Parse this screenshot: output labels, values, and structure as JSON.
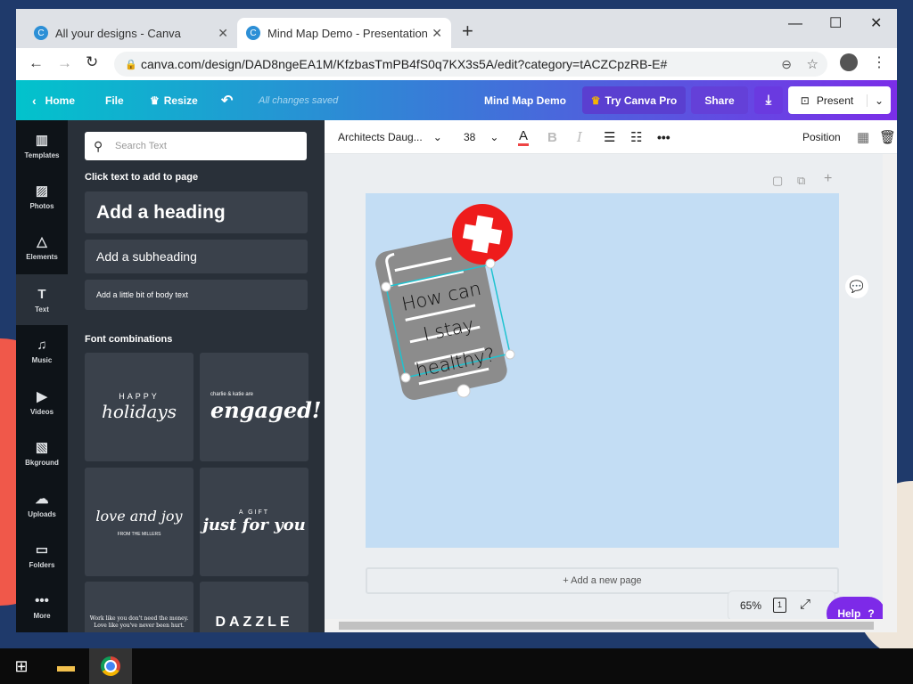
{
  "browser": {
    "tabs": [
      {
        "title": "All your designs - Canva",
        "favicon": "C"
      },
      {
        "title": "Mind Map Demo - Presentation",
        "favicon": "C"
      }
    ],
    "new_tab": "+",
    "url": "canva.com/design/DAD8ngeEA1M/KfzbasTmPB4fS0q7KX3s5A/edit?category=tACZCpzRB-E#"
  },
  "header": {
    "home": "Home",
    "file": "File",
    "resize": "Resize",
    "status": "All changes saved",
    "doc_title": "Mind Map Demo",
    "try_pro": "Try Canva Pro",
    "share": "Share",
    "present": "Present"
  },
  "rail": [
    {
      "label": "Templates",
      "icon": "▥"
    },
    {
      "label": "Photos",
      "icon": "▨"
    },
    {
      "label": "Elements",
      "icon": "△"
    },
    {
      "label": "Text",
      "icon": "T"
    },
    {
      "label": "Music",
      "icon": "♫"
    },
    {
      "label": "Videos",
      "icon": "▶"
    },
    {
      "label": "Bkground",
      "icon": "▧"
    },
    {
      "label": "Uploads",
      "icon": "☁"
    },
    {
      "label": "Folders",
      "icon": "▭"
    },
    {
      "label": "More",
      "icon": "•••"
    }
  ],
  "panel": {
    "search_placeholder": "Search Text",
    "click_to_add": "Click text to add to page",
    "heading": "Add a heading",
    "subheading": "Add a subheading",
    "body": "Add a little bit of body text",
    "font_combos_title": "Font combinations",
    "combos": [
      {
        "small": "HAPPY",
        "big": "holidays",
        "sub": ""
      },
      {
        "small": "charlie & katie are",
        "big": "engaged!",
        "sub": ""
      },
      {
        "small": "",
        "big": "love and joy",
        "sub": "FROM THE MILLERS"
      },
      {
        "small": "A GIFT",
        "big": "just for you",
        "sub": ""
      },
      {
        "small": "Work like you don't need the money.",
        "big": "",
        "sub": "Love like you've never been hurt."
      },
      {
        "small": "",
        "big": "DAZZLE",
        "sub": ""
      }
    ]
  },
  "toolbar": {
    "font": "Architects Daug...",
    "size": "38",
    "position": "Position"
  },
  "canvas": {
    "text": [
      "How can",
      "I stay",
      "healthy?"
    ],
    "add_page": "+ Add a new page",
    "zoom": "65%",
    "page_num": "1",
    "help": "Help",
    "help_icon": "?"
  },
  "colors": {
    "accent": "#7d2ae8",
    "page": "#c3ddf4",
    "panel": "#293039"
  }
}
